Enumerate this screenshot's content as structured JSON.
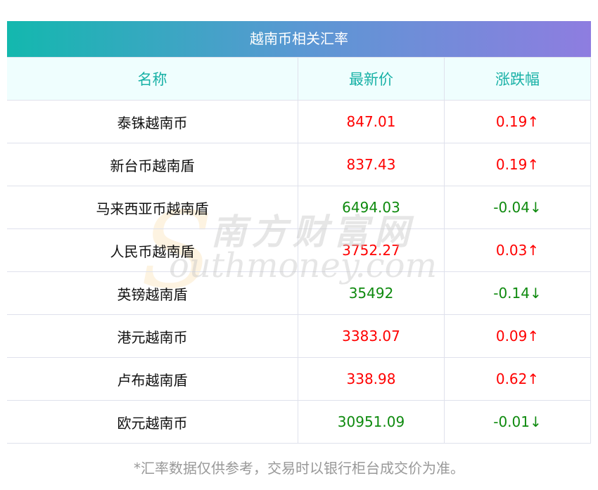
{
  "title": "越南币相关汇率",
  "headers": [
    "名称",
    "最新价",
    "涨跌幅"
  ],
  "rows": [
    {
      "name": "泰铢越南币",
      "price": "847.01",
      "change": "0.19↑",
      "dir": "up"
    },
    {
      "name": "新台币越南盾",
      "price": "837.43",
      "change": "0.19↑",
      "dir": "up"
    },
    {
      "name": "马来西亚币越南盾",
      "price": "6494.03",
      "change": "-0.04↓",
      "dir": "down"
    },
    {
      "name": "人民币越南盾",
      "price": "3752.27",
      "change": "0.03↑",
      "dir": "up"
    },
    {
      "name": "英镑越南盾",
      "price": "35492",
      "change": "-0.14↓",
      "dir": "down"
    },
    {
      "name": "港元越南币",
      "price": "3383.07",
      "change": "0.09↑",
      "dir": "up"
    },
    {
      "name": "卢布越南盾",
      "price": "338.98",
      "change": "0.62↑",
      "dir": "up"
    },
    {
      "name": "欧元越南币",
      "price": "30951.09",
      "change": "-0.01↓",
      "dir": "down"
    }
  ],
  "note": "*汇率数据仅供参考，交易时以银行柜台成交价为准。",
  "watermark": {
    "cn": "南方财富网",
    "en": "outhmoney.com",
    "s": "S"
  }
}
